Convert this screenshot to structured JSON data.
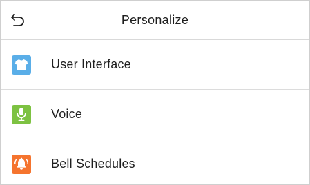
{
  "header": {
    "title": "Personalize",
    "back_icon": "undo-arrow-icon"
  },
  "menu": {
    "items": [
      {
        "label": "User Interface",
        "icon": "tshirt-icon",
        "color": "#5aaee8"
      },
      {
        "label": "Voice",
        "icon": "microphone-icon",
        "color": "#7dc242"
      },
      {
        "label": "Bell Schedules",
        "icon": "bell-icon",
        "color": "#f5742e"
      }
    ]
  }
}
